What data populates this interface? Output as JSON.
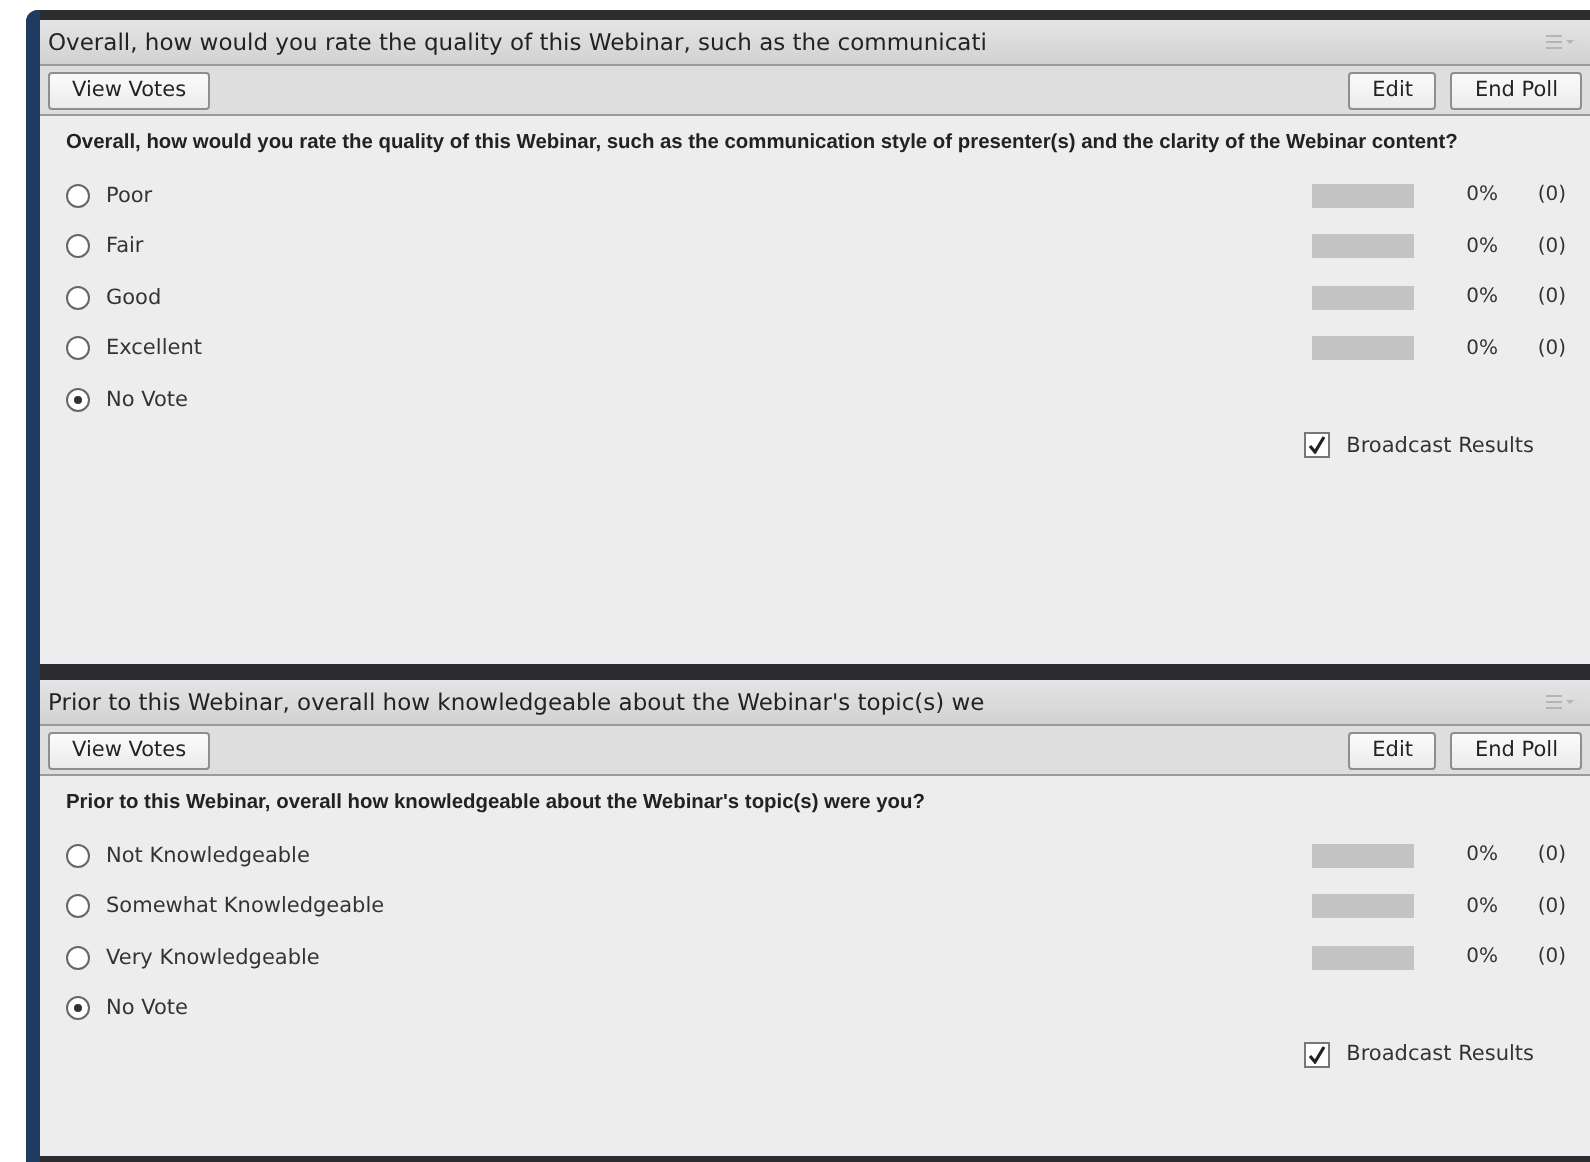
{
  "polls": [
    {
      "title": "Overall, how would you rate the quality of this Webinar, such as the communicati",
      "view_votes": "View Votes",
      "edit": "Edit",
      "end_poll": "End Poll",
      "question": "Overall, how would you rate the quality of this Webinar, such as the communication style of presenter(s) and the clarity of the Webinar content?",
      "options": [
        {
          "label": "Poor",
          "selected": false,
          "level": 0,
          "percent": "0%",
          "count": "(0)"
        },
        {
          "label": "Fair",
          "selected": false,
          "level": 0,
          "percent": "0%",
          "count": "(0)"
        },
        {
          "label": "Good",
          "selected": false,
          "level": 0,
          "percent": "0%",
          "count": "(0)"
        },
        {
          "label": "Excellent",
          "selected": false,
          "level": 0,
          "percent": "0%",
          "count": "(0)"
        },
        {
          "label": "No Vote",
          "selected": true
        }
      ],
      "broadcast": {
        "label": "Broadcast Results",
        "checked": true
      }
    },
    {
      "title": "Prior to this Webinar, overall how knowledgeable about the Webinar's topic(s) we",
      "view_votes": "View Votes",
      "edit": "Edit",
      "end_poll": "End Poll",
      "question": "Prior to this Webinar, overall how knowledgeable about the Webinar's topic(s) were you?",
      "options": [
        {
          "label": "Not Knowledgeable",
          "selected": false,
          "level": 0,
          "percent": "0%",
          "count": "(0)"
        },
        {
          "label": "Somewhat Knowledgeable",
          "selected": false,
          "level": 0,
          "percent": "0%",
          "count": "(0)"
        },
        {
          "label": "Very Knowledgeable",
          "selected": false,
          "level": 0,
          "percent": "0%",
          "count": "(0)"
        },
        {
          "label": "No Vote",
          "selected": true
        }
      ],
      "broadcast": {
        "label": "Broadcast Results",
        "checked": true
      }
    }
  ]
}
